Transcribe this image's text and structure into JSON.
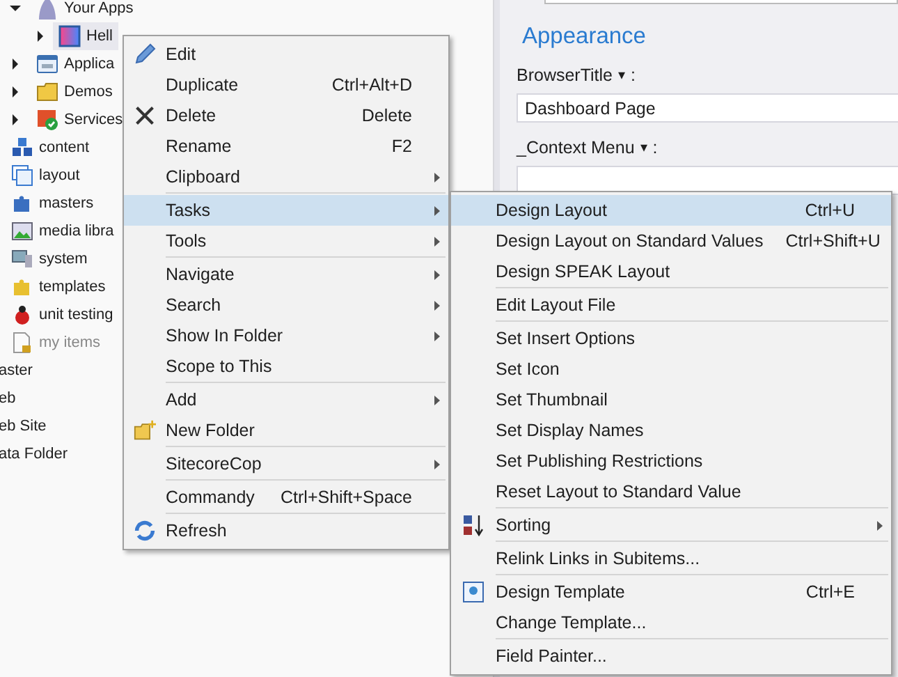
{
  "tree": {
    "deep_items": [
      {
        "label": "Your Apps",
        "expanded": true,
        "children": [
          {
            "label": "Hell",
            "expanded": false
          }
        ]
      },
      {
        "label": "Applica",
        "expanded": false
      },
      {
        "label": "Demos",
        "expanded": false
      },
      {
        "label": "Services",
        "expanded": false
      }
    ],
    "items": [
      {
        "label": "content",
        "disabled": false
      },
      {
        "label": "layout",
        "disabled": false
      },
      {
        "label": "masters",
        "disabled": false
      },
      {
        "label": "media libra",
        "disabled": false
      },
      {
        "label": "system",
        "disabled": false
      },
      {
        "label": "templates",
        "disabled": false
      },
      {
        "label": "unit testing",
        "disabled": false
      },
      {
        "label": "my items",
        "disabled": true
      }
    ],
    "root_items": [
      {
        "label": "aster"
      },
      {
        "label": "eb"
      },
      {
        "label": "eb Site"
      },
      {
        "label": "ata Folder"
      }
    ]
  },
  "editor": {
    "section_title": "Appearance",
    "fields": [
      {
        "label": "BrowserTitle",
        "dropdown_mark": "▾",
        "colon": ":",
        "value": "Dashboard Page"
      },
      {
        "label": "_Context Menu",
        "dropdown_mark": "▾",
        "colon": ":"
      }
    ]
  },
  "context_menu": {
    "groups": [
      [
        {
          "label": "Edit",
          "has_submenu": false,
          "selected": false
        },
        {
          "label": "Duplicate",
          "shortcut": "Ctrl+Alt+D",
          "has_submenu": false,
          "selected": false
        },
        {
          "label": "Delete",
          "shortcut": "Delete",
          "has_submenu": false,
          "selected": false
        },
        {
          "label": "Rename",
          "shortcut": "F2",
          "has_submenu": false,
          "selected": false
        },
        {
          "label": "Clipboard",
          "has_submenu": true,
          "selected": false
        }
      ],
      [
        {
          "label": "Tasks",
          "has_submenu": true,
          "selected": true
        },
        {
          "label": "Tools",
          "has_submenu": true,
          "selected": false
        }
      ],
      [
        {
          "label": "Navigate",
          "has_submenu": true,
          "selected": false
        },
        {
          "label": "Search",
          "has_submenu": true,
          "selected": false
        },
        {
          "label": "Show In Folder",
          "has_submenu": true,
          "selected": false
        },
        {
          "label": "Scope to This",
          "has_submenu": false,
          "selected": false
        }
      ],
      [
        {
          "label": "Add",
          "has_submenu": true,
          "selected": false
        },
        {
          "label": "New Folder",
          "has_submenu": false,
          "selected": false
        }
      ],
      [
        {
          "label": "SitecoreCop",
          "has_submenu": true,
          "selected": false
        }
      ],
      [
        {
          "label": "Commandy",
          "shortcut": "Ctrl+Shift+Space",
          "has_submenu": false,
          "selected": false
        }
      ],
      [
        {
          "label": "Refresh",
          "has_submenu": false,
          "selected": false
        }
      ]
    ]
  },
  "submenu": {
    "groups": [
      [
        {
          "label": "Design Layout",
          "shortcut": "Ctrl+U",
          "has_submenu": false,
          "selected": true
        },
        {
          "label": "Design Layout on Standard Values",
          "shortcut": "Ctrl+Shift+U",
          "has_submenu": false,
          "selected": false
        },
        {
          "label": "Design SPEAK Layout",
          "has_submenu": false,
          "selected": false
        }
      ],
      [
        {
          "label": "Edit Layout File",
          "has_submenu": false,
          "selected": false
        }
      ],
      [
        {
          "label": "Set Insert Options",
          "has_submenu": false,
          "selected": false
        },
        {
          "label": "Set Icon",
          "has_submenu": false,
          "selected": false
        },
        {
          "label": "Set Thumbnail",
          "has_submenu": false,
          "selected": false
        },
        {
          "label": "Set Display Names",
          "has_submenu": false,
          "selected": false
        },
        {
          "label": "Set Publishing Restrictions",
          "has_submenu": false,
          "selected": false
        },
        {
          "label": "Reset Layout to Standard Value",
          "has_submenu": false,
          "selected": false
        }
      ],
      [
        {
          "label": "Sorting",
          "has_submenu": true,
          "selected": false
        }
      ],
      [
        {
          "label": "Relink Links in Subitems...",
          "has_submenu": false,
          "selected": false
        }
      ],
      [
        {
          "label": "Design Template",
          "shortcut": "Ctrl+E",
          "has_submenu": false,
          "selected": false
        },
        {
          "label": "Change Template...",
          "has_submenu": false,
          "selected": false
        }
      ],
      [
        {
          "label": "Field Painter...",
          "has_submenu": false,
          "selected": false
        }
      ]
    ]
  }
}
